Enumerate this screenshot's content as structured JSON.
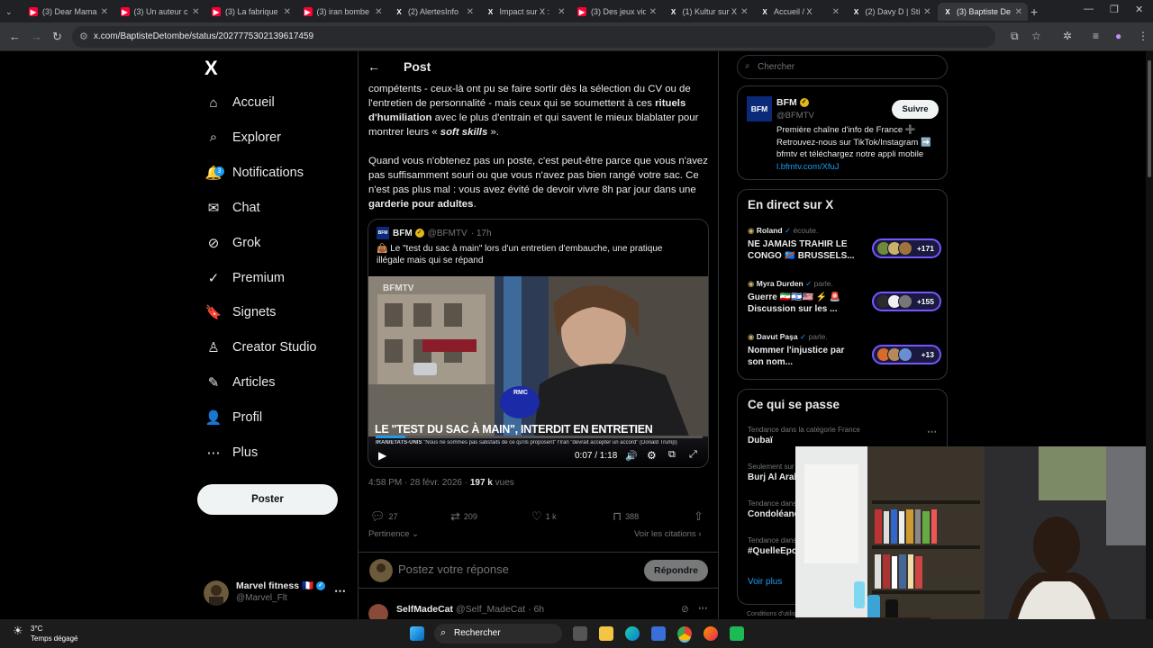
{
  "browser": {
    "tabs": [
      {
        "label": "(3) Dear Mama",
        "icon": "youtube-icon"
      },
      {
        "label": "(3) Un auteur c",
        "icon": "youtube-icon"
      },
      {
        "label": "(3) La fabrique",
        "icon": "youtube-icon"
      },
      {
        "label": "(3) iran bombe",
        "icon": "youtube-icon"
      },
      {
        "label": "(2) AlertesInfo",
        "icon": "x-icon"
      },
      {
        "label": "Impact sur X :",
        "icon": "x-icon"
      },
      {
        "label": "(3) Des jeux vid",
        "icon": "youtube-icon"
      },
      {
        "label": "(1) Kultur sur X",
        "icon": "x-icon"
      },
      {
        "label": "Accueil / X",
        "icon": "x-icon"
      },
      {
        "label": "(2) Davy D | Sti",
        "icon": "x-icon"
      },
      {
        "label": "(3) Baptiste De",
        "icon": "x-icon",
        "active": true
      }
    ],
    "url": "x.com/BaptisteDetombe/status/2027775302139617459"
  },
  "sidebar": {
    "logo": "X",
    "items": [
      {
        "label": "Accueil",
        "icon": "home-icon",
        "glyph": "⌂"
      },
      {
        "label": "Explorer",
        "icon": "search-icon",
        "glyph": "⌕"
      },
      {
        "label": "Notifications",
        "icon": "bell-icon",
        "glyph": "🔔",
        "badge": "3"
      },
      {
        "label": "Chat",
        "icon": "mail-icon",
        "glyph": "✉"
      },
      {
        "label": "Grok",
        "icon": "grok-icon",
        "glyph": "⊘"
      },
      {
        "label": "Premium",
        "icon": "verified-icon",
        "glyph": "✓"
      },
      {
        "label": "Signets",
        "icon": "bookmark-icon",
        "glyph": "🔖"
      },
      {
        "label": "Creator Studio",
        "icon": "creator-icon",
        "glyph": "♙"
      },
      {
        "label": "Articles",
        "icon": "article-icon",
        "glyph": "✎"
      },
      {
        "label": "Profil",
        "icon": "profile-icon",
        "glyph": "👤"
      },
      {
        "label": "Plus",
        "icon": "more-icon",
        "glyph": "⋯"
      }
    ],
    "post_button": "Poster",
    "account": {
      "name": "Marvel fitness 🇫🇷",
      "handle": "@Marvel_Flt"
    }
  },
  "main": {
    "header": "Post",
    "paragraph1": {
      "a": "compétents - ceux-là ont pu se faire sortir dès la sélection du CV ou de l'entretien de personnalité - mais ceux qui se soumettent à ces ",
      "b": "rituels d'humiliation",
      "c": " avec le plus d'entrain et qui savent le mieux blablater pour montrer leurs « ",
      "d": "soft skills",
      "e": " »."
    },
    "paragraph2": {
      "a": "Quand vous n'obtenez pas un poste, c'est peut-être parce que vous n'avez pas suffisamment souri ou que vous n'avez pas bien rangé votre sac. Ce n'est pas plus mal : vous avez évité de devoir vivre 8h par jour dans une ",
      "b": "garderie pour adultes",
      "c": "."
    },
    "quote": {
      "author": "BFM",
      "handle": "@BFMTV",
      "time": "· 17h",
      "text": "👜 Le \"test du sac à main\" lors d'un entretien d'embauche, une pratique illégale mais qui se répand",
      "video": {
        "channel_logo": "BFMTV",
        "banner": "LE \"TEST DU SAC À MAIN\", INTERDIT EN ENTRETIEN",
        "ticker_label": "IRAN/ÉTATS-UNIS",
        "ticker_text": "\"Nous ne sommes pas satisfaits de ce qu'ils proposent\" l'Iran \"devrait accepter un accord\" (Donald Trump)",
        "mic_text": "RMC",
        "time": "0:07 / 1:18",
        "progress": 0.09
      }
    },
    "meta": {
      "time": "4:58 PM · 28 févr. 2026 · ",
      "views": "197 k",
      "views_label": " vues"
    },
    "actions": {
      "replies": "27",
      "reposts": "209",
      "likes": "1 k",
      "bookmarks": "388"
    },
    "relevance": "Pertinence ⌄",
    "citations": "Voir les citations ›",
    "reply_placeholder": "Postez votre réponse",
    "reply_button": "Répondre",
    "next_tweet": {
      "name": "SelfMadeCat",
      "handle": "@Self_MadeCat · 6h"
    }
  },
  "right": {
    "search_placeholder": "Chercher",
    "bfm_card": {
      "name": "BFM",
      "handle": "@BFMTV",
      "logo": "BFM",
      "follow": "Suivre",
      "bio": "Première chaîne d'info de France ➕ Retrouvez-nous sur TikTok/Instagram ➡️ bfmtv et téléchargez notre appli mobile",
      "link": "l.bfmtv.com/XfuJ"
    },
    "live": {
      "title": "En direct sur X",
      "items": [
        {
          "host": "Roland",
          "status": "écoute.",
          "title": "NE JAMAIS TRAHIR LE CONGO 🇨🇩 BRUSSELS...",
          "count": "+171"
        },
        {
          "host": "Myra Durden",
          "status": "parle.",
          "title": "Guerre 🇮🇷🇮🇱🇺🇸 ⚡ 🚨 Discussion sur les ...",
          "count": "+155"
        },
        {
          "host": "Davut Paşa",
          "status": "parle.",
          "title": "Nommer l'injustice par son nom...",
          "count": "+13"
        }
      ]
    },
    "trends": {
      "title": "Ce qui se passe",
      "items": [
        {
          "category": "Tendance dans la catégorie France",
          "name": "Dubaï"
        },
        {
          "category": "Seulement sur X",
          "name": "Burj Al Arab"
        },
        {
          "category": "Tendance dans la catégorie France",
          "name": "Condoléances"
        },
        {
          "category": "Tendance dans la catégorie France",
          "name": "#QuelleEpoque"
        }
      ],
      "more": "Voir plus"
    },
    "footer": "Conditions d'utilisation"
  },
  "taskbar": {
    "weather_temp": "3°C",
    "weather_desc": "Temps dégagé",
    "search": "Rechercher"
  }
}
